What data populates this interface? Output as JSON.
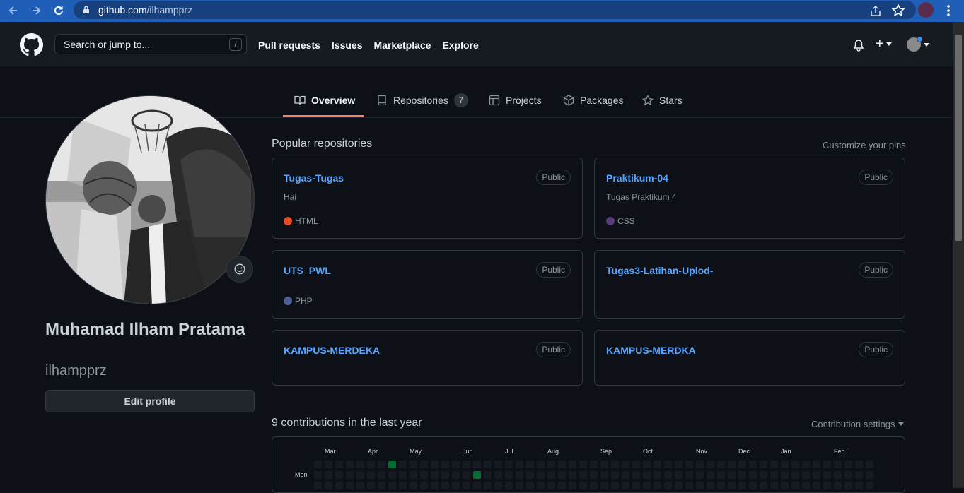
{
  "browser": {
    "url_host": "github.com",
    "url_path": "/ilhampprz"
  },
  "header": {
    "search_placeholder": "Search or jump to...",
    "search_shortcut": "/",
    "nav": [
      "Pull requests",
      "Issues",
      "Marketplace",
      "Explore"
    ],
    "new_menu_label": "+"
  },
  "tabs": [
    {
      "label": "Overview",
      "icon": "book-icon",
      "active": true
    },
    {
      "label": "Repositories",
      "icon": "repo-icon",
      "count": "7"
    },
    {
      "label": "Projects",
      "icon": "table-icon"
    },
    {
      "label": "Packages",
      "icon": "package-icon"
    },
    {
      "label": "Stars",
      "icon": "star-icon"
    }
  ],
  "profile": {
    "name": "Muhamad Ilham Pratama",
    "login": "ilhampprz",
    "edit_label": "Edit profile"
  },
  "pinned": {
    "title": "Popular repositories",
    "customize": "Customize your pins",
    "repos": [
      {
        "name": "Tugas-Tugas",
        "visibility": "Public",
        "description": "Hai",
        "language": "HTML",
        "lang_color": "#e34c26"
      },
      {
        "name": "Praktikum-04",
        "visibility": "Public",
        "description": "Tugas Praktikum 4",
        "language": "CSS",
        "lang_color": "#563d7c"
      },
      {
        "name": "UTS_PWL",
        "visibility": "Public",
        "description": "",
        "language": "PHP",
        "lang_color": "#4f5d95"
      },
      {
        "name": "Tugas3-Latihan-Uplod-",
        "visibility": "Public",
        "description": "",
        "language": "",
        "lang_color": ""
      },
      {
        "name": "KAMPUS-MERDEKA",
        "visibility": "Public",
        "description": "",
        "language": "",
        "lang_color": ""
      },
      {
        "name": "KAMPUS-MERDKA",
        "visibility": "Public",
        "description": "",
        "language": "",
        "lang_color": ""
      }
    ]
  },
  "contributions": {
    "title": "9 contributions in the last year",
    "settings": "Contribution settings",
    "months": [
      "Mar",
      "Apr",
      "May",
      "Jun",
      "Jul",
      "Aug",
      "Sep",
      "Oct",
      "Nov",
      "Dec",
      "Jan",
      "Feb"
    ],
    "day_label": "Mon",
    "colors": {
      "empty": "#161b22",
      "level1": "#0e4429",
      "level2": "#006d32"
    }
  }
}
